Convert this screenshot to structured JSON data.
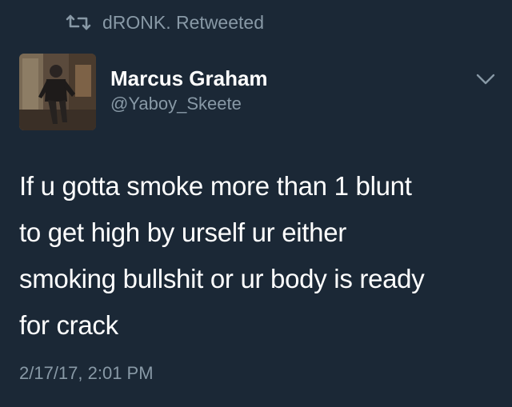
{
  "retweet": {
    "icon": "retweet-icon",
    "text": "dRONK. Retweeted"
  },
  "author": {
    "display_name": "Marcus Graham",
    "handle": "@Yaboy_Skeete",
    "avatar": "avatar-photo"
  },
  "tweet": {
    "lines": [
      "If u gotta smoke more than 1 blunt",
      "to get high by urself ur either",
      "smoking bullshit or ur body is ready",
      "for crack"
    ],
    "timestamp": "2/17/17, 2:01 PM"
  },
  "menu": {
    "icon": "chevron-down-icon"
  },
  "colors": {
    "background": "#1b2836",
    "primary_text": "#ffffff",
    "secondary_text": "#8899a6"
  }
}
